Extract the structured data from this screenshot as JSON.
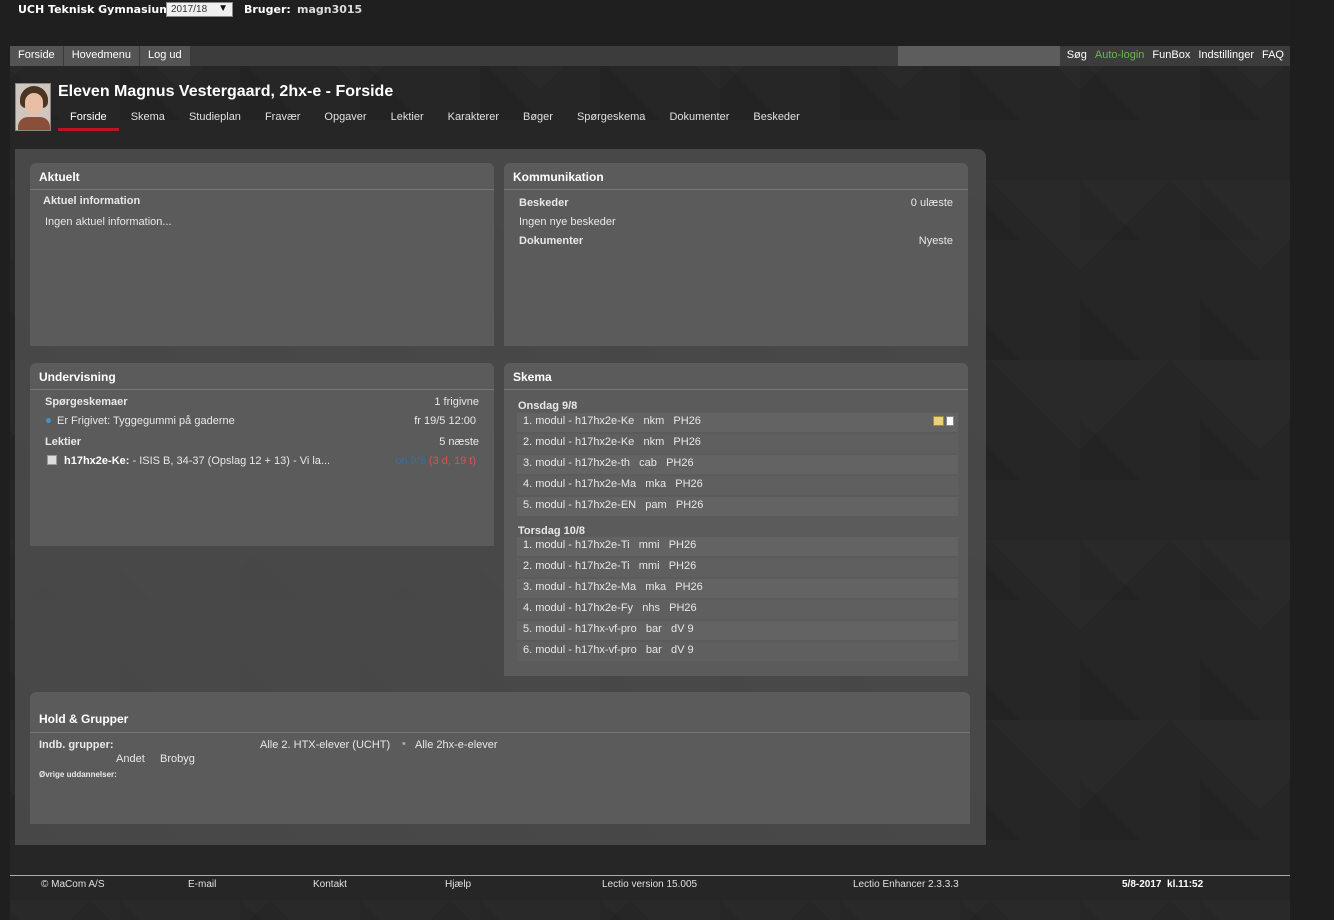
{
  "topbar": {
    "school": "UCH Teknisk Gymnasium",
    "year": "2017/18",
    "user_label": "Bruger:",
    "user_name": "magn3015"
  },
  "nav": {
    "left": [
      "Forside",
      "Hovedmenu",
      "Log ud"
    ],
    "right": [
      {
        "label": "Søg",
        "color": "#ffffff"
      },
      {
        "label": "Auto-login",
        "color": "#6ab84a"
      },
      {
        "label": "FunBox",
        "color": "#ffffff"
      },
      {
        "label": "Indstillinger",
        "color": "#ffffff"
      },
      {
        "label": "FAQ",
        "color": "#ffffff"
      }
    ]
  },
  "header": {
    "title": "Eleven Magnus Vestergaard, 2hx-e - Forside",
    "tabs": [
      "Forside",
      "Skema",
      "Studieplan",
      "Fravær",
      "Opgaver",
      "Lektier",
      "Karakterer",
      "Bøger",
      "Spørgeskema",
      "Dokumenter",
      "Beskeder"
    ],
    "active_tab": "Forside"
  },
  "aktuelt": {
    "title": "Aktuelt",
    "subheading": "Aktuel information",
    "text": "Ingen aktuel information..."
  },
  "kommunikation": {
    "title": "Kommunikation",
    "beskeder_label": "Beskeder",
    "beskeder_link": "0 ulæste",
    "beskeder_text": "Ingen nye beskeder",
    "dokumenter_label": "Dokumenter",
    "dokumenter_link": "Nyeste"
  },
  "undervisning": {
    "title": "Undervisning",
    "sporgeskemaer_label": "Spørgeskemaer",
    "sporgeskemaer_link": "1 frigivne",
    "survey_item": "Er Frigivet: Tyggegummi på gaderne",
    "survey_date": "fr 19/5 12:00",
    "lektier_label": "Lektier",
    "lektier_link": "5 næste",
    "homework_course": "h17hx2e-Ke:",
    "homework_text": " - ISIS B, 34-37 (Opslag 12 + 13) - Vi la...",
    "homework_date": "on 9/8",
    "homework_due": "(3 d, 19 t)"
  },
  "skema": {
    "title": "Skema",
    "days": [
      {
        "label": "Onsdag 9/8",
        "rows": [
          "1. modul - h17hx2e-Ke   nkm   PH26",
          "2. modul - h17hx2e-Ke   nkm   PH26",
          "3. modul - h17hx2e-th   cab   PH26",
          "4. modul - h17hx2e-Ma   mka   PH26",
          "5. modul - h17hx2e-EN   pam   PH26"
        ]
      },
      {
        "label": "Torsdag 10/8",
        "rows": [
          "1. modul - h17hx2e-Ti   mmi   PH26",
          "2. modul - h17hx2e-Ti   mmi   PH26",
          "3. modul - h17hx2e-Ma   mka   PH26",
          "4. modul - h17hx2e-Fy   nhs   PH26",
          "5. modul - h17hx-vf-pro   bar   dV 9",
          "6. modul - h17hx-vf-pro   bar   dV 9"
        ]
      }
    ]
  },
  "hold": {
    "title": "Hold & Grupper",
    "indb_label": "Indb. grupper:",
    "group1": "Alle 2. HTX-elever (UCHT)",
    "group2": "Alle 2hx-e-elever",
    "andet": "Andet",
    "brobyg": "Brobyg",
    "ovrige": "Øvrige uddannelser:"
  },
  "footer": {
    "company": "© MaCom A/S",
    "email": "E-mail",
    "kontakt": "Kontakt",
    "hjaelp": "Hjælp",
    "version": "Lectio version 15.005",
    "enhancer": "Lectio Enhancer 2.3.3.3",
    "datetime": "5/8-2017  kl.11:52"
  }
}
